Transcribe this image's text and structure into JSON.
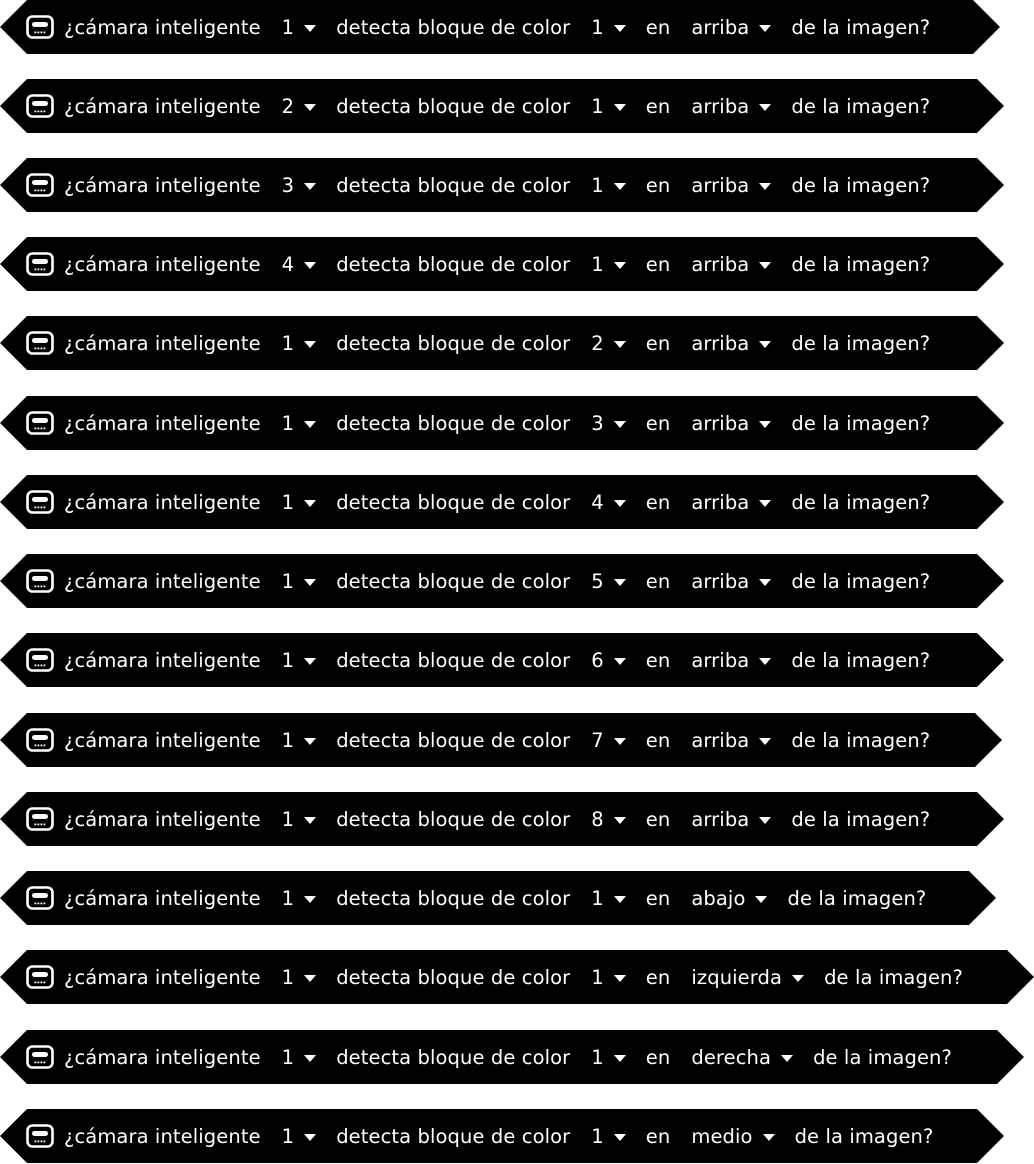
{
  "block_text": {
    "prefix": "¿cámara inteligente",
    "middle": "detecta bloque de color",
    "connector": "en",
    "suffix": "de la imagen?"
  },
  "icon": "smart-camera-icon",
  "colors": {
    "block_background": "#000000",
    "block_text": "#ffffff"
  },
  "blocks": [
    {
      "camera": "1",
      "color": "1",
      "position": "arriba"
    },
    {
      "camera": "2",
      "color": "1",
      "position": "arriba"
    },
    {
      "camera": "3",
      "color": "1",
      "position": "arriba"
    },
    {
      "camera": "4",
      "color": "1",
      "position": "arriba"
    },
    {
      "camera": "1",
      "color": "2",
      "position": "arriba"
    },
    {
      "camera": "1",
      "color": "3",
      "position": "arriba"
    },
    {
      "camera": "1",
      "color": "4",
      "position": "arriba"
    },
    {
      "camera": "1",
      "color": "5",
      "position": "arriba"
    },
    {
      "camera": "1",
      "color": "6",
      "position": "arriba"
    },
    {
      "camera": "1",
      "color": "7",
      "position": "arriba"
    },
    {
      "camera": "1",
      "color": "8",
      "position": "arriba"
    },
    {
      "camera": "1",
      "color": "1",
      "position": "abajo"
    },
    {
      "camera": "1",
      "color": "1",
      "position": "izquierda"
    },
    {
      "camera": "1",
      "color": "1",
      "position": "derecha"
    },
    {
      "camera": "1",
      "color": "1",
      "position": "medio"
    }
  ]
}
